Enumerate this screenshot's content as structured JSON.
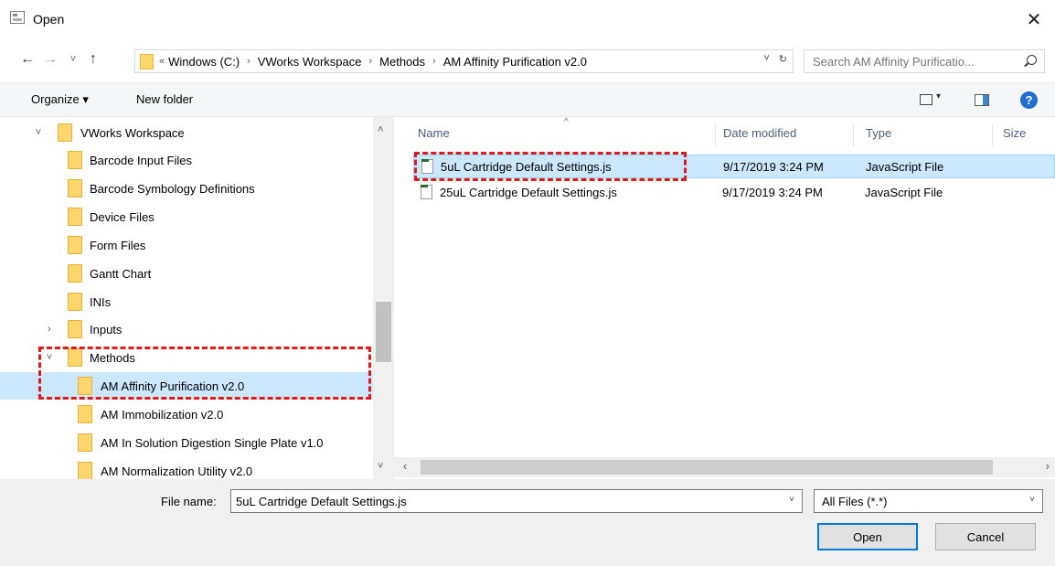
{
  "window": {
    "title": "Open",
    "close_glyph": "✕"
  },
  "nav": {
    "back_glyph": "←",
    "forward_glyph": "→",
    "recent_glyph": "˅",
    "up_glyph": "↑",
    "breadcrumb_prefix": "«",
    "breadcrumbs": [
      "Windows (C:)",
      "VWorks Workspace",
      "Methods",
      "AM Affinity Purification v2.0"
    ],
    "address_dropdown_glyph": "˅",
    "refresh_glyph": "↻",
    "search_placeholder": "Search AM Affinity Purificatio..."
  },
  "toolbar": {
    "organize_label": "Organize ▾",
    "new_folder_label": "New folder",
    "view_arrow": "▾",
    "help_glyph": "?"
  },
  "tree": {
    "items": [
      {
        "label": "VWorks Workspace",
        "expander": "˅"
      },
      {
        "label": "Barcode Input Files"
      },
      {
        "label": "Barcode Symbology Definitions"
      },
      {
        "label": "Device Files"
      },
      {
        "label": "Form Files"
      },
      {
        "label": "Gantt Chart"
      },
      {
        "label": "INIs"
      },
      {
        "label": "Inputs",
        "expander": "›"
      },
      {
        "label": "Methods",
        "expander": "˅"
      },
      {
        "label": "AM Affinity Purification v2.0",
        "selected": true
      },
      {
        "label": "AM Immobilization v2.0"
      },
      {
        "label": "AM In Solution Digestion Single Plate v1.0"
      },
      {
        "label": "AM Normalization Utility v2.0"
      }
    ],
    "scroll_up": "˄",
    "scroll_down": "˅"
  },
  "filelist": {
    "columns": [
      "Name",
      "Date modified",
      "Type",
      "Size"
    ],
    "sort_glyph": "^",
    "rows": [
      {
        "name": "5uL Cartridge Default Settings.js",
        "date": "9/17/2019 3:24 PM",
        "type": "JavaScript File",
        "selected": true
      },
      {
        "name": "25uL Cartridge Default Settings.js",
        "date": "9/17/2019 3:24 PM",
        "type": "JavaScript File",
        "selected": false
      }
    ],
    "hscroll_left": "‹",
    "hscroll_right": "›"
  },
  "bottom": {
    "file_name_label": "File name:",
    "file_name_value": "5uL Cartridge Default Settings.js",
    "filter_value": "All Files (*.*)",
    "dropdown_glyph": "˅",
    "open_label": "Open",
    "cancel_label": "Cancel"
  },
  "colors": {
    "selection": "#cce8ff",
    "annotation": "#e01a1a",
    "accent": "#0078d7",
    "folder": "#ffd66b"
  }
}
